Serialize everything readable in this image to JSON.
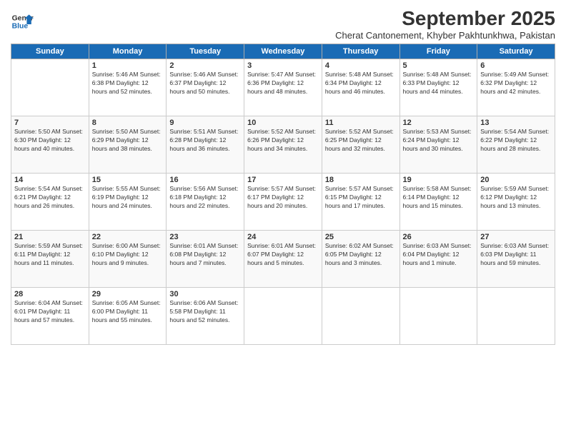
{
  "logo": {
    "line1": "General",
    "line2": "Blue"
  },
  "title": "September 2025",
  "subtitle": "Cherat Cantonement, Khyber Pakhtunkhwa, Pakistan",
  "days_of_week": [
    "Sunday",
    "Monday",
    "Tuesday",
    "Wednesday",
    "Thursday",
    "Friday",
    "Saturday"
  ],
  "weeks": [
    [
      {
        "num": "",
        "info": ""
      },
      {
        "num": "1",
        "info": "Sunrise: 5:46 AM\nSunset: 6:38 PM\nDaylight: 12 hours\nand 52 minutes."
      },
      {
        "num": "2",
        "info": "Sunrise: 5:46 AM\nSunset: 6:37 PM\nDaylight: 12 hours\nand 50 minutes."
      },
      {
        "num": "3",
        "info": "Sunrise: 5:47 AM\nSunset: 6:36 PM\nDaylight: 12 hours\nand 48 minutes."
      },
      {
        "num": "4",
        "info": "Sunrise: 5:48 AM\nSunset: 6:34 PM\nDaylight: 12 hours\nand 46 minutes."
      },
      {
        "num": "5",
        "info": "Sunrise: 5:48 AM\nSunset: 6:33 PM\nDaylight: 12 hours\nand 44 minutes."
      },
      {
        "num": "6",
        "info": "Sunrise: 5:49 AM\nSunset: 6:32 PM\nDaylight: 12 hours\nand 42 minutes."
      }
    ],
    [
      {
        "num": "7",
        "info": "Sunrise: 5:50 AM\nSunset: 6:30 PM\nDaylight: 12 hours\nand 40 minutes."
      },
      {
        "num": "8",
        "info": "Sunrise: 5:50 AM\nSunset: 6:29 PM\nDaylight: 12 hours\nand 38 minutes."
      },
      {
        "num": "9",
        "info": "Sunrise: 5:51 AM\nSunset: 6:28 PM\nDaylight: 12 hours\nand 36 minutes."
      },
      {
        "num": "10",
        "info": "Sunrise: 5:52 AM\nSunset: 6:26 PM\nDaylight: 12 hours\nand 34 minutes."
      },
      {
        "num": "11",
        "info": "Sunrise: 5:52 AM\nSunset: 6:25 PM\nDaylight: 12 hours\nand 32 minutes."
      },
      {
        "num": "12",
        "info": "Sunrise: 5:53 AM\nSunset: 6:24 PM\nDaylight: 12 hours\nand 30 minutes."
      },
      {
        "num": "13",
        "info": "Sunrise: 5:54 AM\nSunset: 6:22 PM\nDaylight: 12 hours\nand 28 minutes."
      }
    ],
    [
      {
        "num": "14",
        "info": "Sunrise: 5:54 AM\nSunset: 6:21 PM\nDaylight: 12 hours\nand 26 minutes."
      },
      {
        "num": "15",
        "info": "Sunrise: 5:55 AM\nSunset: 6:19 PM\nDaylight: 12 hours\nand 24 minutes."
      },
      {
        "num": "16",
        "info": "Sunrise: 5:56 AM\nSunset: 6:18 PM\nDaylight: 12 hours\nand 22 minutes."
      },
      {
        "num": "17",
        "info": "Sunrise: 5:57 AM\nSunset: 6:17 PM\nDaylight: 12 hours\nand 20 minutes."
      },
      {
        "num": "18",
        "info": "Sunrise: 5:57 AM\nSunset: 6:15 PM\nDaylight: 12 hours\nand 17 minutes."
      },
      {
        "num": "19",
        "info": "Sunrise: 5:58 AM\nSunset: 6:14 PM\nDaylight: 12 hours\nand 15 minutes."
      },
      {
        "num": "20",
        "info": "Sunrise: 5:59 AM\nSunset: 6:12 PM\nDaylight: 12 hours\nand 13 minutes."
      }
    ],
    [
      {
        "num": "21",
        "info": "Sunrise: 5:59 AM\nSunset: 6:11 PM\nDaylight: 12 hours\nand 11 minutes."
      },
      {
        "num": "22",
        "info": "Sunrise: 6:00 AM\nSunset: 6:10 PM\nDaylight: 12 hours\nand 9 minutes."
      },
      {
        "num": "23",
        "info": "Sunrise: 6:01 AM\nSunset: 6:08 PM\nDaylight: 12 hours\nand 7 minutes."
      },
      {
        "num": "24",
        "info": "Sunrise: 6:01 AM\nSunset: 6:07 PM\nDaylight: 12 hours\nand 5 minutes."
      },
      {
        "num": "25",
        "info": "Sunrise: 6:02 AM\nSunset: 6:05 PM\nDaylight: 12 hours\nand 3 minutes."
      },
      {
        "num": "26",
        "info": "Sunrise: 6:03 AM\nSunset: 6:04 PM\nDaylight: 12 hours\nand 1 minute."
      },
      {
        "num": "27",
        "info": "Sunrise: 6:03 AM\nSunset: 6:03 PM\nDaylight: 11 hours\nand 59 minutes."
      }
    ],
    [
      {
        "num": "28",
        "info": "Sunrise: 6:04 AM\nSunset: 6:01 PM\nDaylight: 11 hours\nand 57 minutes."
      },
      {
        "num": "29",
        "info": "Sunrise: 6:05 AM\nSunset: 6:00 PM\nDaylight: 11 hours\nand 55 minutes."
      },
      {
        "num": "30",
        "info": "Sunrise: 6:06 AM\nSunset: 5:58 PM\nDaylight: 11 hours\nand 52 minutes."
      },
      {
        "num": "",
        "info": ""
      },
      {
        "num": "",
        "info": ""
      },
      {
        "num": "",
        "info": ""
      },
      {
        "num": "",
        "info": ""
      }
    ]
  ]
}
